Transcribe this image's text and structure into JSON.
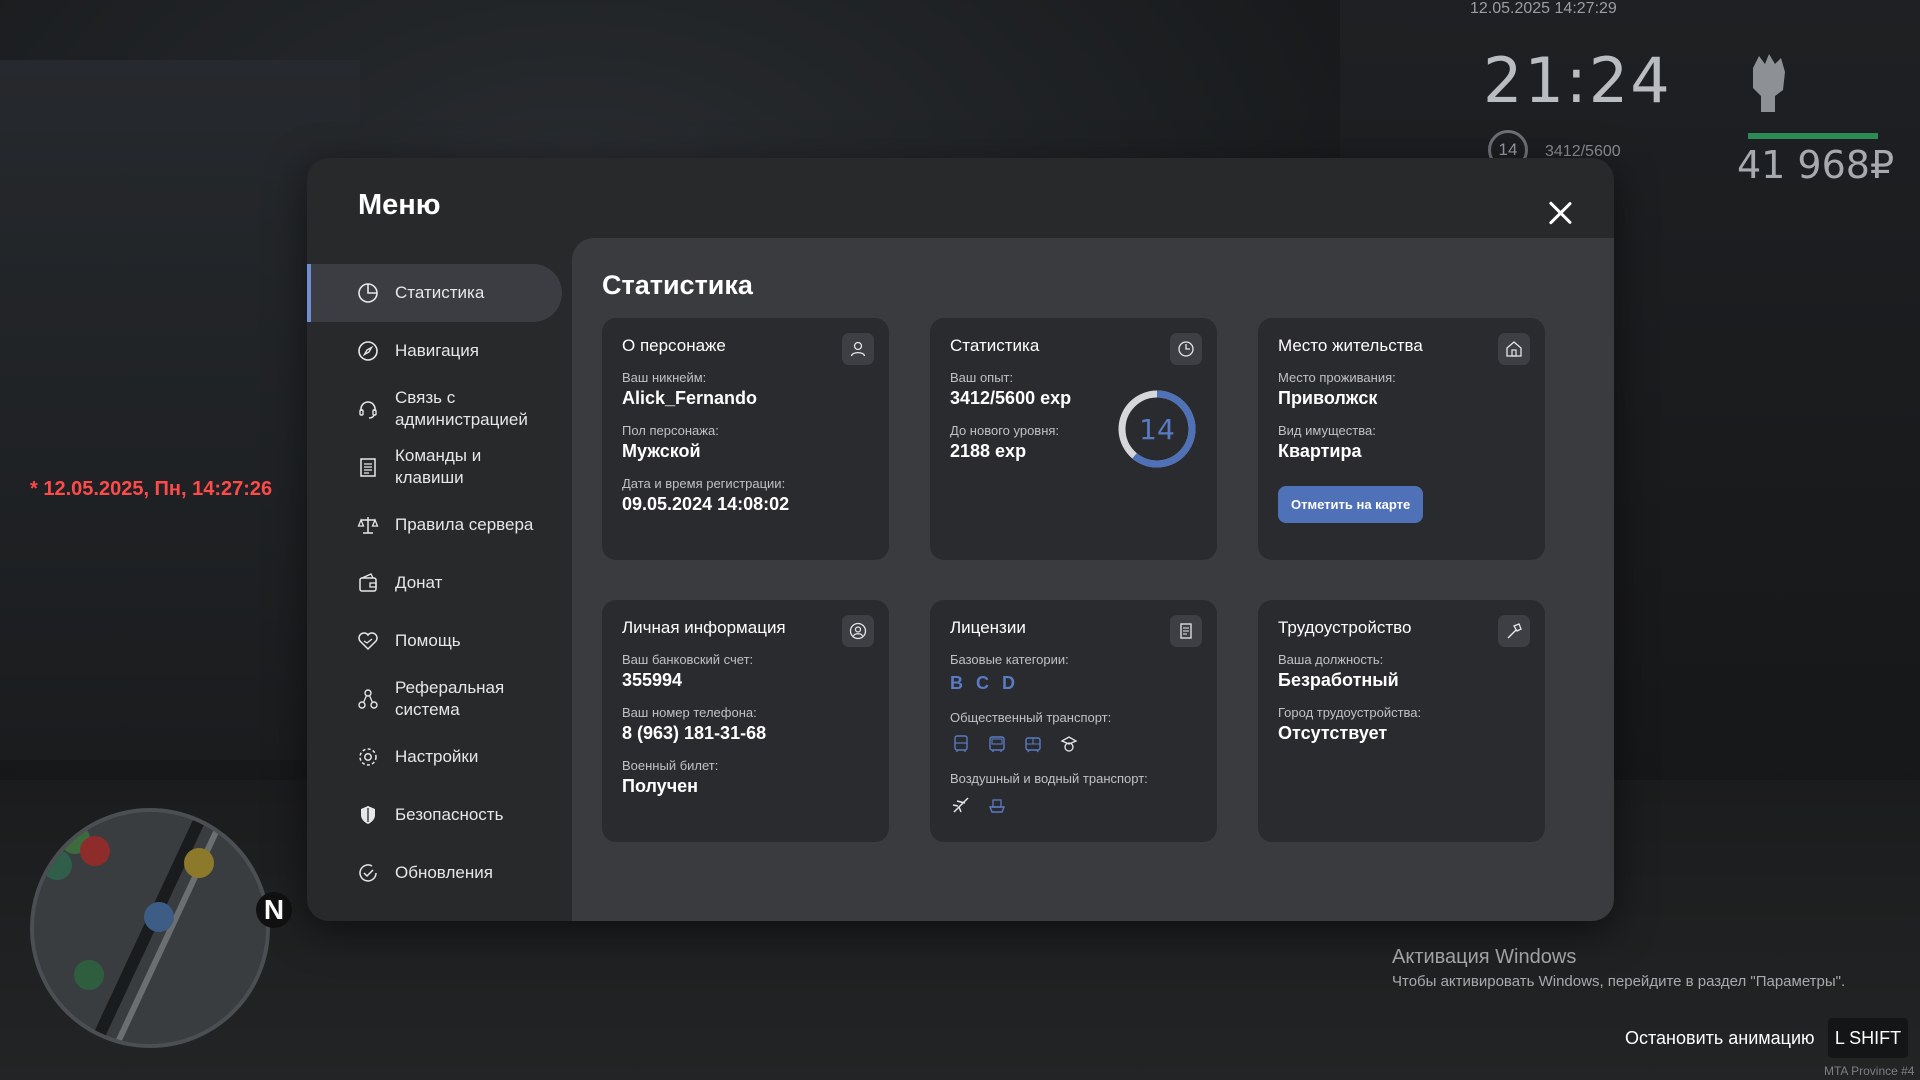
{
  "hud": {
    "date_top": "12.05.2025 14:27:29",
    "clock": "21:24",
    "level": "14",
    "exp": "3412/5600",
    "money": "41 968₽",
    "health_color": "#2c8a55",
    "red_datetime": "* 12.05.2025, Пн, 14:27:26",
    "minimap_north": "N"
  },
  "windows_activation": {
    "title": "Активация Windows",
    "subtitle": "Чтобы активировать Windows, перейдите в раздел \"Параметры\"."
  },
  "stop_animation": {
    "label": "Остановить анимацию",
    "key": "L SHIFT"
  },
  "server_tag": "MTA Province #4",
  "menu": {
    "title": "Меню",
    "accent_color": "#5a7bc4",
    "sidebar": [
      {
        "label": "Статистика",
        "icon": "pie-chart-icon",
        "active": true
      },
      {
        "label": "Навигация",
        "icon": "compass-icon"
      },
      {
        "label": "Связь с администрацией",
        "icon": "headset-icon"
      },
      {
        "label": "Команды и клавиши",
        "icon": "document-list-icon"
      },
      {
        "label": "Правила сервера",
        "icon": "scales-icon"
      },
      {
        "label": "Донат",
        "icon": "wallet-icon"
      },
      {
        "label": "Помощь",
        "icon": "handshake-heart-icon"
      },
      {
        "label": "Реферальная система",
        "icon": "referral-network-icon"
      },
      {
        "label": "Настройки",
        "icon": "gear-icon"
      },
      {
        "label": "Безопасность",
        "icon": "shield-icon"
      },
      {
        "label": "Обновления",
        "icon": "update-check-icon"
      }
    ],
    "content_title": "Статистика",
    "cards": {
      "character": {
        "title": "О персонаже",
        "icon": "user-icon",
        "nick_label": "Ваш никнейм:",
        "nick": "Alick_Fernando",
        "gender_label": "Пол персонажа:",
        "gender": "Мужской",
        "reg_label": "Дата и время регистрации:",
        "reg": "09.05.2024 14:08:02"
      },
      "stats": {
        "title": "Статистика",
        "icon": "clock-pie-icon",
        "exp_label": "Ваш опыт:",
        "exp": "3412/5600 exp",
        "next_label": "До нового уровня:",
        "next": "2188 exp",
        "level": "14",
        "progress": 0.61
      },
      "residence": {
        "title": "Место жительства",
        "icon": "house-icon",
        "place_label": "Место проживания:",
        "place": "Приволжск",
        "property_label": "Вид имущества:",
        "property": "Квартира",
        "button": "Отметить на карте"
      },
      "personal": {
        "title": "Личная информация",
        "icon": "id-user-icon",
        "bank_label": "Ваш банковский счет:",
        "bank": "355994",
        "phone_label": "Ваш номер телефона:",
        "phone": "8 (963) 181-31-68",
        "military_label": "Военный билет:",
        "military": "Получен"
      },
      "licenses": {
        "title": "Лицензии",
        "icon": "license-card-icon",
        "base_label": "Базовые категории:",
        "categories": [
          "B",
          "C",
          "D"
        ],
        "public_label": "Общественный транспорт:",
        "public_icons": [
          "bus-icon",
          "trolleybus-icon",
          "tram-icon",
          "taxi-driver-icon"
        ],
        "air_label": "Воздушный и водный транспорт:",
        "air_icons": [
          "airplane-icon",
          "boat-icon"
        ]
      },
      "job": {
        "title": "Трудоустройство",
        "icon": "hammer-icon",
        "position_label": "Ваша должность:",
        "position": "Безработный",
        "city_label": "Город трудоустройства:",
        "city": "Отсутствует"
      }
    }
  }
}
